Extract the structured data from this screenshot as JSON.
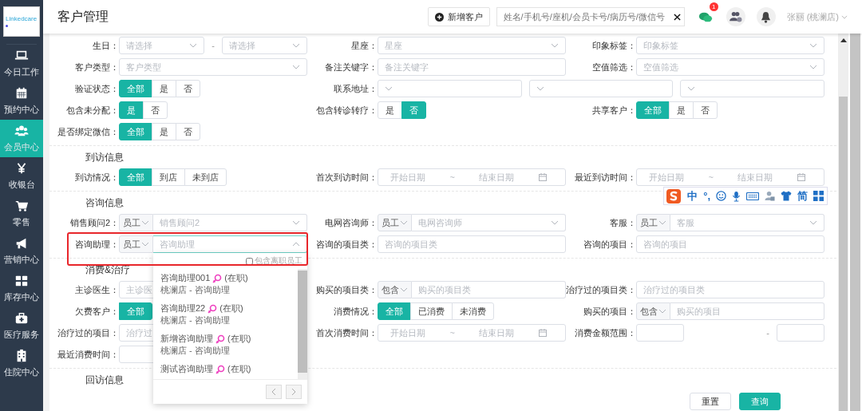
{
  "logo": "Linkedcare",
  "sidebar": {
    "items": [
      {
        "label": "今日工作",
        "kind": "laptop",
        "selected": false
      },
      {
        "label": "预约中心",
        "kind": "calendar",
        "selected": false
      },
      {
        "label": "会员中心",
        "kind": "people",
        "selected": true
      },
      {
        "label": "收银台",
        "kind": "yen",
        "selected": false
      },
      {
        "label": "零售",
        "kind": "cart",
        "selected": false
      },
      {
        "label": "营销中心",
        "kind": "megaphone",
        "selected": false
      },
      {
        "label": "库存中心",
        "kind": "grid",
        "selected": false
      },
      {
        "label": "医疗服务",
        "kind": "medkit",
        "selected": false
      },
      {
        "label": "住院中心",
        "kind": "building",
        "selected": false
      }
    ]
  },
  "header": {
    "title": "客户管理",
    "new_button": "新增客户",
    "search": {
      "placeholder": "姓名/手机号/座机/会员卡号/病历号/微信号"
    },
    "chat_badge": "1",
    "user": "张丽 (桃澜店)"
  },
  "sections": [
    {
      "rows": [
        [
          {
            "label": "生日：",
            "kind": "select_range",
            "placeholders": [
              "请选择",
              "请选择"
            ],
            "separator": "-"
          },
          {
            "label": "星座：",
            "kind": "select",
            "placeholder": "星座"
          },
          {
            "label": "印象标签：",
            "kind": "select",
            "placeholder": "印象标签"
          }
        ],
        [
          {
            "label": "客户类型：",
            "kind": "select",
            "placeholder": "客户类型"
          },
          {
            "label": "备注关键字：",
            "kind": "input",
            "placeholder": "备注关键字"
          },
          {
            "label": "空值筛选：",
            "kind": "select",
            "placeholder": "空值筛选"
          }
        ],
        [
          {
            "label": "验证状态：",
            "kind": "segmented",
            "options": [
              {
                "label": "全部",
                "selected": true
              },
              {
                "label": "是",
                "selected": false
              },
              {
                "label": "否",
                "selected": false
              }
            ]
          },
          {
            "label": "联系地址：",
            "kind": "address"
          }
        ],
        [
          {
            "label": "包含未分配：",
            "kind": "segmented",
            "options": [
              {
                "label": "是",
                "selected": true
              },
              {
                "label": "否",
                "selected": false
              }
            ]
          },
          {
            "label": "包含转诊转疗：",
            "kind": "segmented",
            "options": [
              {
                "label": "是",
                "selected": false
              },
              {
                "label": "否",
                "selected": true
              }
            ]
          },
          {
            "label": "共享客户：",
            "kind": "segmented",
            "options": [
              {
                "label": "全部",
                "selected": true
              },
              {
                "label": "是",
                "selected": false
              },
              {
                "label": "否",
                "selected": false
              }
            ]
          }
        ],
        [
          {
            "label": "是否绑定微信：",
            "kind": "segmented",
            "options": [
              {
                "label": "全部",
                "selected": true
              },
              {
                "label": "是",
                "selected": false
              },
              {
                "label": "否",
                "selected": false
              }
            ]
          }
        ]
      ]
    },
    {
      "title": "到访信息",
      "rows": [
        [
          {
            "label": "到访情况：",
            "kind": "segmented",
            "options": [
              {
                "label": "全部",
                "selected": true
              },
              {
                "label": "到店",
                "selected": false
              },
              {
                "label": "未到店",
                "selected": false
              }
            ]
          },
          {
            "label": "首次到访时间：",
            "kind": "date_range",
            "start": "开始日期",
            "separator": "~",
            "end": "结束日期"
          },
          {
            "label": "最近到访时间：",
            "kind": "date_range",
            "start": "开始日期",
            "separator": "~",
            "end": "结束日期",
            "ime_toolbar": [
              {
                "kind": "logo"
              },
              {
                "kind": "text",
                "text": "中"
              },
              {
                "kind": "text",
                "text": "°,"
              },
              {
                "kind": "smiley"
              },
              {
                "kind": "mic"
              },
              {
                "kind": "keyboard"
              },
              {
                "kind": "person"
              },
              {
                "kind": "shirt"
              },
              {
                "kind": "text",
                "text": "简"
              },
              {
                "kind": "tiles"
              }
            ]
          }
        ]
      ]
    },
    {
      "title": "咨询信息",
      "rows": [
        [
          {
            "label": "销售顾问2：",
            "kind": "prefixed_select",
            "prefix": "员工",
            "placeholder": "销售顾问2"
          },
          {
            "label": "电网咨询师：",
            "kind": "prefixed_select",
            "prefix": "员工",
            "placeholder": "电网咨询师"
          },
          {
            "label": "客服：",
            "kind": "prefixed_select",
            "prefix": "员工",
            "placeholder": "客服"
          }
        ],
        [
          {
            "label": "咨询助理：",
            "kind": "prefixed_select",
            "prefix": "员工",
            "placeholder": "咨询助理",
            "highlighted": true,
            "open": true,
            "dropdown": {
              "checkbox": {
                "label": "包含离职员工",
                "checked": false
              },
              "options": [
                {
                  "name": "咨询助理001",
                  "status": "(在职)",
                  "store": "桃澜店 - 咨询助理"
                },
                {
                  "name": "咨询助理22",
                  "status": "(在职)",
                  "store": "桃澜店 - 咨询助理"
                },
                {
                  "name": "新增咨询助理",
                  "status": "(在职)",
                  "store": "桃澜店 - 咨询助理"
                },
                {
                  "name": "测试咨询助理",
                  "status": "(在职)"
                }
              ]
            }
          },
          {
            "label": "咨询的项目类：",
            "kind": "input",
            "placeholder": "咨询的项目类"
          },
          {
            "label": "咨询的项目：",
            "kind": "input",
            "placeholder": "咨询的项目"
          }
        ]
      ]
    },
    {
      "title": "消费&治疗",
      "rows": [
        [
          {
            "label": "主诊医生：",
            "kind": "input",
            "placeholder": "主诊医"
          },
          {
            "label": "购买的项目类：",
            "kind": "prefixed_input",
            "prefix": "包含",
            "placeholder": "购买的项目类"
          },
          {
            "label": "治疗过的项目类：",
            "kind": "input",
            "placeholder": "治疗过的项目类"
          }
        ],
        [
          {
            "label": "欠费客户：",
            "kind": "segmented",
            "options": [
              {
                "label": "全部",
                "selected": true
              }
            ]
          },
          {
            "label": "消费情况：",
            "kind": "segmented",
            "options": [
              {
                "label": "全部",
                "selected": true
              },
              {
                "label": "已消费",
                "selected": false
              },
              {
                "label": "未消费",
                "selected": false
              }
            ]
          },
          {
            "label": "购买的项目：",
            "kind": "prefixed_input",
            "prefix": "包含",
            "placeholder": "购买的项目"
          }
        ],
        [
          {
            "label": "治疗过的项目：",
            "kind": "input",
            "placeholder": "治疗过"
          },
          {
            "label": "首次消费时间：",
            "kind": "date_range",
            "start": "开始日期",
            "separator": "~",
            "end": "结束日期"
          },
          {
            "label": "消费金额范围：",
            "kind": "number_range",
            "separator": "-"
          }
        ],
        [
          {
            "label": "最近消费时间：",
            "kind": "input"
          }
        ]
      ]
    },
    {
      "title": "回访信息"
    }
  ],
  "buttons": [
    {
      "label": "重置",
      "kind": "secondary"
    },
    {
      "label": "查询",
      "kind": "primary"
    }
  ]
}
